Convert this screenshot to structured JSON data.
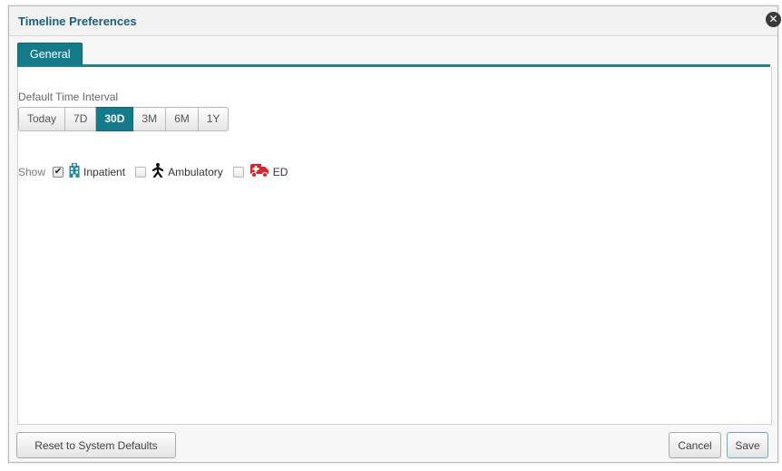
{
  "dialog": {
    "title": "Timeline Preferences",
    "close_icon": "close-icon",
    "tabs": [
      {
        "label": "General",
        "active": true
      }
    ]
  },
  "interval": {
    "label": "Default Time Interval",
    "options": [
      "Today",
      "7D",
      "30D",
      "3M",
      "6M",
      "1Y"
    ],
    "selected": "30D"
  },
  "show": {
    "label": "Show",
    "items": [
      {
        "label": "Inpatient",
        "checked": true,
        "icon": "hospital-icon"
      },
      {
        "label": "Ambulatory",
        "checked": false,
        "icon": "walking-person-icon"
      },
      {
        "label": "ED",
        "checked": false,
        "icon": "ambulance-icon"
      }
    ]
  },
  "footer": {
    "reset_label": "Reset to System Defaults",
    "cancel_label": "Cancel",
    "save_label": "Save"
  },
  "colors": {
    "accent": "#157b8a",
    "title": "#1a5f7a",
    "ambulance": "#d7272c"
  }
}
